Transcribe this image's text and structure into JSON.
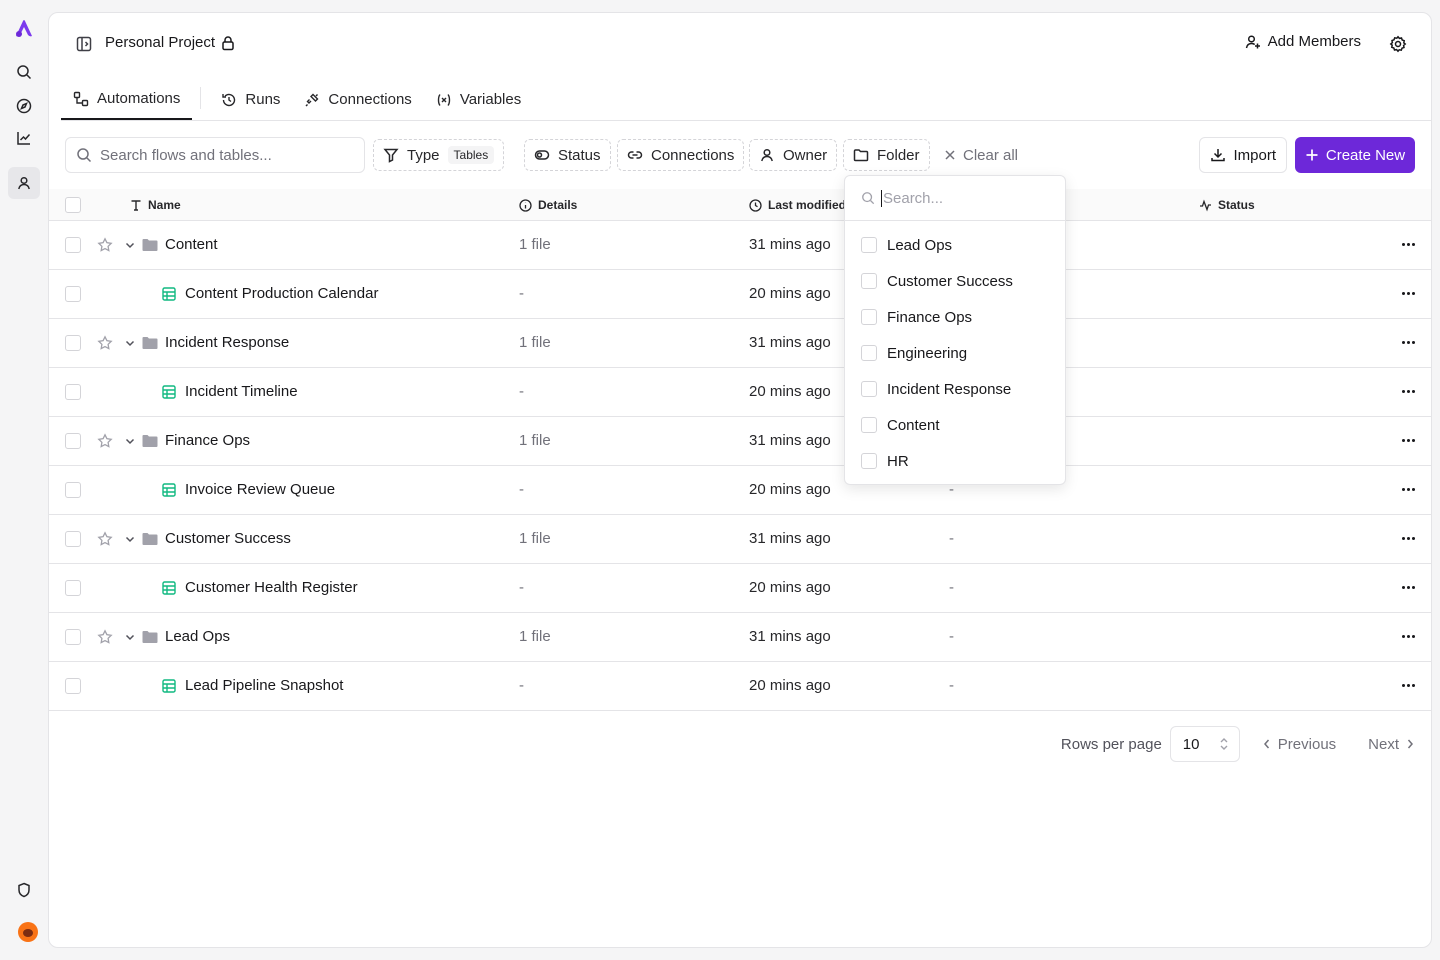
{
  "project": {
    "name": "Personal Project"
  },
  "header": {
    "add_members": "Add Members"
  },
  "tabs": [
    {
      "label": "Automations",
      "active": true
    },
    {
      "label": "Runs"
    },
    {
      "label": "Connections"
    },
    {
      "label": "Variables"
    }
  ],
  "filters": {
    "search_placeholder": "Search flows and tables...",
    "type": "Type",
    "type_tag": "Tables",
    "status": "Status",
    "connections": "Connections",
    "owner": "Owner",
    "folder": "Folder",
    "clear_all": "Clear all",
    "import": "Import",
    "create_new": "Create New"
  },
  "table": {
    "columns": {
      "name": "Name",
      "details": "Details",
      "last_modified": "Last modified",
      "status": "Status"
    },
    "rows": [
      {
        "kind": "folder",
        "name": "Content",
        "details": "1 file",
        "modified": "31 mins ago",
        "status": ""
      },
      {
        "kind": "table",
        "name": "Content Production Calendar",
        "details": "-",
        "modified": "20 mins ago",
        "status": ""
      },
      {
        "kind": "folder",
        "name": "Incident Response",
        "details": "1 file",
        "modified": "31 mins ago",
        "status": ""
      },
      {
        "kind": "table",
        "name": "Incident Timeline",
        "details": "-",
        "modified": "20 mins ago",
        "status": ""
      },
      {
        "kind": "folder",
        "name": "Finance Ops",
        "details": "1 file",
        "modified": "31 mins ago",
        "status": ""
      },
      {
        "kind": "table",
        "name": "Invoice Review Queue",
        "details": "-",
        "modified": "20 mins ago",
        "status": "-"
      },
      {
        "kind": "folder",
        "name": "Customer Success",
        "details": "1 file",
        "modified": "31 mins ago",
        "status": "-"
      },
      {
        "kind": "table",
        "name": "Customer Health Register",
        "details": "-",
        "modified": "20 mins ago",
        "status": "-"
      },
      {
        "kind": "folder",
        "name": "Lead Ops",
        "details": "1 file",
        "modified": "31 mins ago",
        "status": "-"
      },
      {
        "kind": "table",
        "name": "Lead Pipeline Snapshot",
        "details": "-",
        "modified": "20 mins ago",
        "status": "-"
      }
    ]
  },
  "pagination": {
    "rows_per_page_label": "Rows per page",
    "rows_per_page": "10",
    "previous": "Previous",
    "next": "Next"
  },
  "folder_dropdown": {
    "search_placeholder": "Search...",
    "options": [
      "Lead Ops",
      "Customer Success",
      "Finance Ops",
      "Engineering",
      "Incident Response",
      "Content",
      "HR"
    ]
  },
  "colors": {
    "accent": "#6d28d9",
    "table_icon": "#10b981"
  }
}
